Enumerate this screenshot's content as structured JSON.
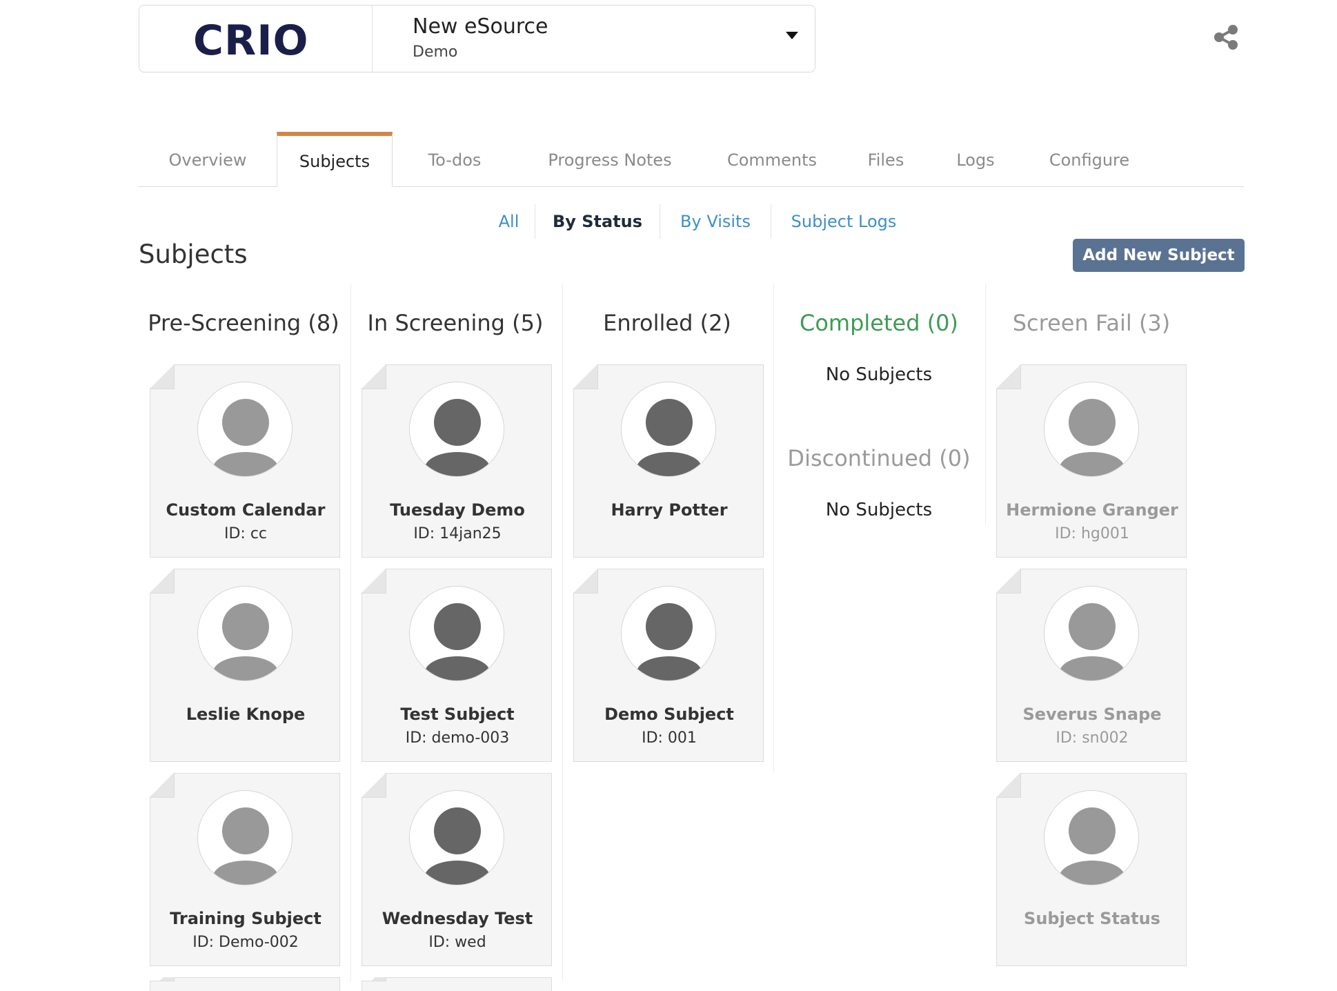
{
  "study": {
    "name": "New eSource",
    "sub": "Demo",
    "logo_text": "CRIO"
  },
  "tabs": [
    {
      "label": "Overview"
    },
    {
      "label": "Subjects"
    },
    {
      "label": "To-dos"
    },
    {
      "label": "Progress Notes"
    },
    {
      "label": "Comments"
    },
    {
      "label": "Files"
    },
    {
      "label": "Logs"
    },
    {
      "label": "Configure"
    }
  ],
  "subnav": [
    {
      "label": "All"
    },
    {
      "label": "By Status"
    },
    {
      "label": "By Visits"
    },
    {
      "label": "Subject Logs"
    }
  ],
  "page": {
    "title": "Subjects",
    "add_button": "Add New Subject"
  },
  "columns": {
    "prescreening": {
      "title": "Pre-Screening (8)",
      "cards": [
        {
          "name": "Custom Calendar",
          "id": "ID: cc"
        },
        {
          "name": "Leslie Knope",
          "id": ""
        },
        {
          "name": "Training Subject",
          "id": "ID: Demo-002"
        }
      ]
    },
    "inscreening": {
      "title": "In Screening (5)",
      "cards": [
        {
          "name": "Tuesday Demo",
          "id": "ID: 14jan25"
        },
        {
          "name": "Test Subject",
          "id": "ID: demo-003"
        },
        {
          "name": "Wednesday Test",
          "id": "ID: wed"
        }
      ]
    },
    "enrolled": {
      "title": "Enrolled (2)",
      "cards": [
        {
          "name": "Harry Potter",
          "id": ""
        },
        {
          "name": "Demo Subject",
          "id": "ID: 001"
        }
      ]
    },
    "completed": {
      "title": "Completed (0)",
      "empty": "No Subjects"
    },
    "discontinued": {
      "title": "Discontinued (0)",
      "empty": "No Subjects"
    },
    "screenfail": {
      "title": "Screen Fail (3)",
      "cards": [
        {
          "name": "Hermione Granger",
          "id": "ID: hg001"
        },
        {
          "name": "Severus Snape",
          "id": "ID: sn002"
        },
        {
          "name": "Subject Status",
          "id": ""
        }
      ]
    }
  },
  "colors": {
    "accent_tab": "#d48645",
    "link": "#3d8fc7",
    "button": "#5b7393",
    "completed": "#3f9a55",
    "muted": "#9a9a9a",
    "avatar_dark": "#666666",
    "avatar_light": "#999999"
  },
  "icons": {
    "share": "share-icon",
    "caret": "chevron-down-icon",
    "avatar": "user-avatar-icon"
  }
}
